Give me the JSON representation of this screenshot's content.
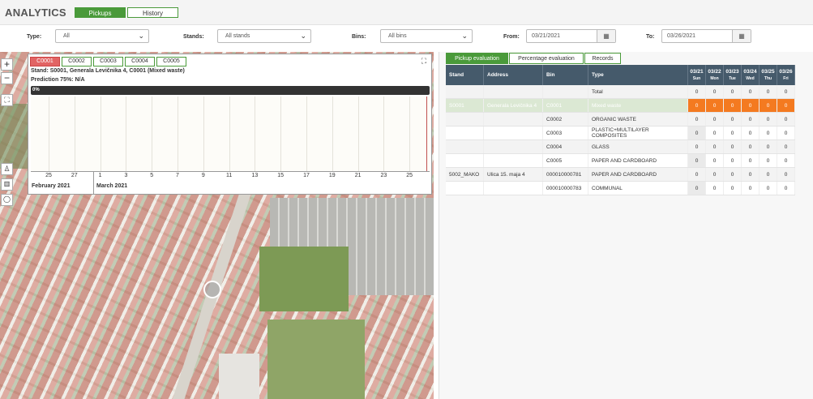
{
  "app": {
    "title": "ANALYTICS"
  },
  "header_tabs": {
    "pickups": "Pickups",
    "history": "History"
  },
  "filters": {
    "type_label": "Type:",
    "type_value": "All",
    "stands_label": "Stands:",
    "stands_value": "All stands",
    "bins_label": "Bins:",
    "bins_value": "All bins",
    "from_label": "From:",
    "from_value": "03/21/2021",
    "to_label": "To:",
    "to_value": "03/26/2021"
  },
  "map_controls": {
    "zoom_in": "+",
    "zoom_out": "−",
    "fullscreen": "⛶"
  },
  "popup": {
    "bins": [
      "C0001",
      "C0002",
      "C0003",
      "C0004",
      "C0005"
    ],
    "stand_info": "Stand: S0001, Generala Levičnika 4, C0001 (Mixed waste)",
    "prediction": "Prediction 75%: N/A",
    "fill_percent": "0%",
    "ticks": [
      "25",
      "27",
      "1",
      "3",
      "5",
      "7",
      "9",
      "11",
      "13",
      "15",
      "17",
      "19",
      "21",
      "23",
      "25"
    ],
    "months": [
      "February 2021",
      "March 2021"
    ]
  },
  "right_tabs": {
    "pickup": "Pickup evaluation",
    "percentage": "Percentage evaluation",
    "records": "Records"
  },
  "table": {
    "headers": {
      "stand": "Stand",
      "address": "Address",
      "bin": "Bin",
      "type": "Type"
    },
    "days": [
      {
        "date": "03/21",
        "dow": "Sun"
      },
      {
        "date": "03/22",
        "dow": "Mon"
      },
      {
        "date": "03/23",
        "dow": "Tue"
      },
      {
        "date": "03/24",
        "dow": "Wed"
      },
      {
        "date": "03/25",
        "dow": "Thu"
      },
      {
        "date": "03/26",
        "dow": "Fri"
      }
    ],
    "rows": [
      {
        "stand": "",
        "address": "",
        "bin": "",
        "type": "Total",
        "vals": [
          "0",
          "0",
          "0",
          "0",
          "0",
          "0"
        ]
      },
      {
        "stand": "S0001",
        "address": "Generala Levičnika 4",
        "bin": "C0001",
        "type": "Mixed waste",
        "vals": [
          "0",
          "0",
          "0",
          "0",
          "0",
          "0"
        ]
      },
      {
        "stand": "",
        "address": "",
        "bin": "C0002",
        "type": "ORGANIC WASTE",
        "vals": [
          "0",
          "0",
          "0",
          "0",
          "0",
          "0"
        ]
      },
      {
        "stand": "",
        "address": "",
        "bin": "C0003",
        "type": "PLASTIC+MULTILAYER COMPOSITES",
        "vals": [
          "0",
          "0",
          "0",
          "0",
          "0",
          "0"
        ]
      },
      {
        "stand": "",
        "address": "",
        "bin": "C0004",
        "type": "GLASS",
        "vals": [
          "0",
          "0",
          "0",
          "0",
          "0",
          "0"
        ]
      },
      {
        "stand": "",
        "address": "",
        "bin": "C0005",
        "type": "PAPER AND CARDBOARD",
        "vals": [
          "0",
          "0",
          "0",
          "0",
          "0",
          "0"
        ]
      },
      {
        "stand": "5002_MAKO",
        "address": "Ulica 15. maja 4",
        "bin": "000010000781",
        "type": "PAPER AND CARDBOARD",
        "vals": [
          "0",
          "0",
          "0",
          "0",
          "0",
          "0"
        ]
      },
      {
        "stand": "",
        "address": "",
        "bin": "000010000783",
        "type": "COMMUNAL",
        "vals": [
          "0",
          "0",
          "0",
          "0",
          "0",
          "0"
        ]
      }
    ]
  },
  "colors": {
    "accent": "#4a9a3a",
    "header": "#455a6b",
    "highlight": "#f47a20",
    "active_bin": "#e26464"
  }
}
